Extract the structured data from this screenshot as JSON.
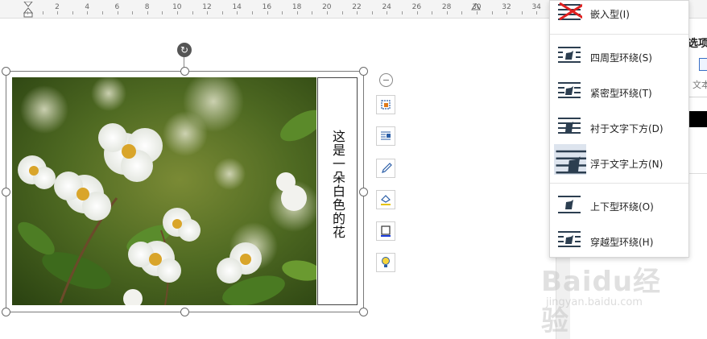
{
  "ruler": {
    "labels": [
      "2",
      "4",
      "6",
      "8",
      "10",
      "12",
      "14",
      "16",
      "18",
      "20",
      "22",
      "24",
      "26",
      "28",
      "30",
      "32",
      "34"
    ]
  },
  "textbox": {
    "text": "这是一朵白色的花"
  },
  "wrap_menu": {
    "items": [
      {
        "label": "嵌入型(I)"
      },
      {
        "label": "四周型环绕(S)"
      },
      {
        "label": "紧密型环绕(T)"
      },
      {
        "label": "衬于文字下方(D)"
      },
      {
        "label": "浮于文字上方(N)"
      },
      {
        "label": "上下型环绕(O)"
      },
      {
        "label": "穿越型环绕(H)"
      }
    ]
  },
  "side_panel": {
    "title": "选项",
    "text": "文本"
  },
  "watermark": {
    "main": "Baidu经验",
    "sub": "jingyan.baidu.com"
  },
  "colors": {
    "accent": "#2b5ea7",
    "icon_dark": "#2c3e50",
    "cross_red": "#e02020"
  }
}
